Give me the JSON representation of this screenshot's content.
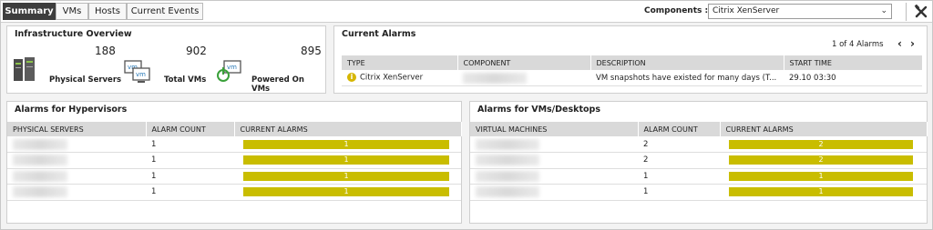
{
  "tabs": [
    {
      "label": "Summary",
      "active": true
    },
    {
      "label": "VMs",
      "active": false
    },
    {
      "label": "Hosts",
      "active": false
    },
    {
      "label": "Current Events",
      "active": false
    }
  ],
  "components": {
    "label": "Components :",
    "selected": "Citrix XenServer"
  },
  "infrastructure": {
    "title": "Infrastructure Overview",
    "metrics": [
      {
        "value": "188",
        "label": "Physical Servers"
      },
      {
        "value": "902",
        "label": "Total VMs"
      },
      {
        "value": "895",
        "label": "Powered On VMs"
      }
    ]
  },
  "current_alarms": {
    "title": "Current Alarms",
    "pager": "1 of 4 Alarms",
    "columns": [
      "TYPE",
      "COMPONENT",
      "DESCRIPTION",
      "START TIME"
    ],
    "row": {
      "type": "Citrix XenServer",
      "description": "VM snapshots have existed for many days (T...",
      "start_time": "29.10   03:30"
    }
  },
  "hypervisors": {
    "title": "Alarms for Hypervisors",
    "columns": [
      "PHYSICAL SERVERS",
      "ALARM COUNT",
      "CURRENT ALARMS"
    ],
    "rows": [
      {
        "count": "1",
        "alarms": "1"
      },
      {
        "count": "1",
        "alarms": "1"
      },
      {
        "count": "1",
        "alarms": "1"
      },
      {
        "count": "1",
        "alarms": "1"
      }
    ]
  },
  "vms": {
    "title": "Alarms for VMs/Desktops",
    "columns": [
      "VIRTUAL MACHINES",
      "ALARM COUNT",
      "CURRENT ALARMS"
    ],
    "rows": [
      {
        "count": "2",
        "alarms": "2"
      },
      {
        "count": "2",
        "alarms": "2"
      },
      {
        "count": "1",
        "alarms": "1"
      },
      {
        "count": "1",
        "alarms": "1"
      }
    ]
  },
  "colors": {
    "accent_bar": "#c9bd00",
    "active_tab": "#3d3d3d",
    "info_icon": "#d6b600"
  }
}
